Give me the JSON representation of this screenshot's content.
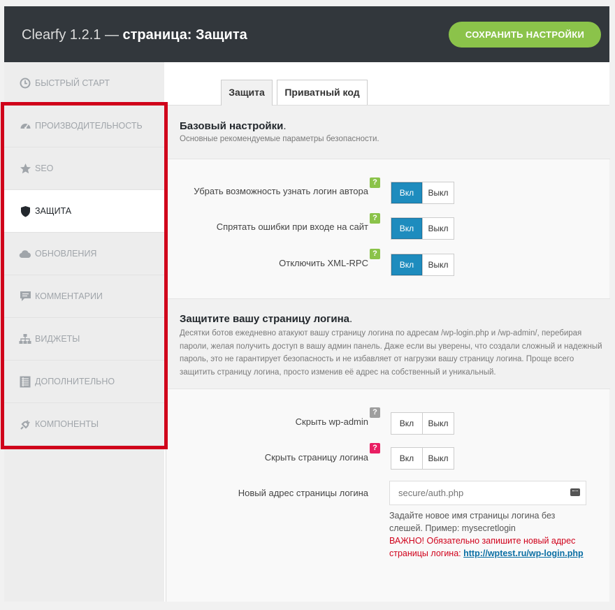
{
  "header": {
    "app_name": "Clearfy 1.2.1",
    "separator": "—",
    "page_title": "страница: Защита",
    "save_label": "СОХРАНИТЬ НАСТРОЙКИ"
  },
  "sidebar": {
    "items": [
      {
        "label": "БЫСТРЫЙ СТАРТ",
        "icon": "clock-icon"
      },
      {
        "label": "ПРОИЗВОДИТЕЛЬНОСТЬ",
        "icon": "dashboard-icon"
      },
      {
        "label": "SEO",
        "icon": "star-icon"
      },
      {
        "label": "ЗАЩИТА",
        "icon": "shield-icon",
        "active": true
      },
      {
        "label": "ОБНОВЛЕНИЯ",
        "icon": "cloud-icon"
      },
      {
        "label": "КОММЕНТАРИИ",
        "icon": "comment-icon"
      },
      {
        "label": "ВИДЖЕТЫ",
        "icon": "sitemap-icon"
      },
      {
        "label": "ДОПОЛНИТЕЛЬНО",
        "icon": "list-icon"
      },
      {
        "label": "КОМПОНЕНТЫ",
        "icon": "plugin-icon"
      }
    ]
  },
  "tabs": [
    {
      "label": "Защита",
      "active": true
    },
    {
      "label": "Приватный код",
      "active": false
    }
  ],
  "basic": {
    "title": "Базовый настройки",
    "title_dot": ".",
    "desc": "Основные рекомендуемые параметры безопасности.",
    "options": [
      {
        "label": "Убрать возможность узнать логин автора",
        "help": "?",
        "on": "Вкл",
        "off": "Выкл",
        "value": "on"
      },
      {
        "label": "Спрятать ошибки при входе на сайт",
        "help": "?",
        "on": "Вкл",
        "off": "Выкл",
        "value": "on"
      },
      {
        "label": "Отключить XML-RPC",
        "help": "?",
        "on": "Вкл",
        "off": "Выкл",
        "value": "on"
      }
    ]
  },
  "login": {
    "title": "Защитите вашу страницу логина",
    "title_dot": ".",
    "desc": "Десятки ботов ежедневно атакуют вашу страницу логина по адресам /wp-login.php и /wp-admin/, перебирая пароли, желая получить доступ в вашу админ панель. Даже если вы уверены, что создали сложный и надежный пароль, это не гарантирует безопасность и не избавляет от нагрузки вашу страницу логина. Проще всего защитить страницу логина, просто изменив её адрес на собственный и уникальный.",
    "options": [
      {
        "label": "Скрыть wp-admin",
        "help": "?",
        "on": "Вкл",
        "off": "Выкл",
        "value": "off"
      },
      {
        "label": "Скрыть страницу логина",
        "help": "?",
        "on": "Вкл",
        "off": "Выкл",
        "value": "off"
      }
    ],
    "new_url": {
      "label": "Новый адрес страницы логина",
      "placeholder": "secure/auth.php",
      "hint": "Задайте новое имя страницы логина без слешей. Пример: mysecretlogin",
      "warning": "ВАЖНО! Обязательно запишите новый адрес страницы логина:",
      "link_text": "http://wptest.ru/wp-login.php"
    }
  },
  "colors": {
    "accent_green": "#8bc34a",
    "toggle_blue": "#1e8cbe",
    "highlight_red": "#d0021b",
    "header_dark": "#32373c"
  }
}
